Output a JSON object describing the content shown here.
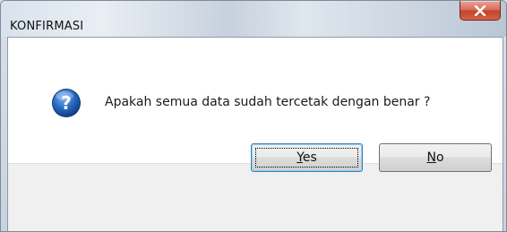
{
  "window": {
    "title": "KONFIRMASI",
    "close_icon": "close-icon"
  },
  "message": {
    "icon": "question-icon",
    "text": "Apakah semua data sudah tercetak dengan benar ?"
  },
  "buttons": {
    "yes": {
      "mnemonic": "Y",
      "rest": "es",
      "label": "Yes"
    },
    "no": {
      "mnemonic": "N",
      "rest": "o",
      "label": "No"
    }
  },
  "colors": {
    "close_button": "#c4432c",
    "question_icon": "#1f5fb8",
    "focus_border": "#3c7fb1"
  }
}
